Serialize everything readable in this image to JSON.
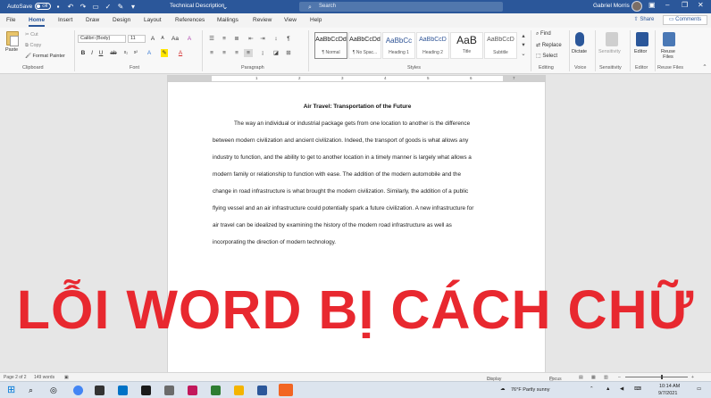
{
  "titlebar": {
    "autosave_label": "AutoSave",
    "autosave_state": "Off",
    "document_title": "Technical Description",
    "search_placeholder": "Search",
    "user_name": "Gabriel Morris"
  },
  "tabs": [
    "File",
    "Home",
    "Insert",
    "Draw",
    "Design",
    "Layout",
    "References",
    "Mailings",
    "Review",
    "View",
    "Help"
  ],
  "active_tab": "Home",
  "share_label": "Share",
  "comments_label": "Comments",
  "ribbon": {
    "clipboard": {
      "paste": "Paste",
      "cut": "Cut",
      "copy": "Copy",
      "format_painter": "Format Painter",
      "label": "Clipboard"
    },
    "font": {
      "name": "Calibri (Body)",
      "size": "11",
      "label": "Font"
    },
    "paragraph": {
      "label": "Paragraph"
    },
    "styles": {
      "items": [
        {
          "preview": "AaBbCcDd",
          "name": "¶ Normal"
        },
        {
          "preview": "AaBbCcDd",
          "name": "¶ No Spac..."
        },
        {
          "preview": "AaBbCc",
          "name": "Heading 1"
        },
        {
          "preview": "AaBbCcD",
          "name": "Heading 2"
        },
        {
          "preview": "AaB",
          "name": "Title"
        },
        {
          "preview": "AaBbCcD",
          "name": "Subtitle"
        }
      ],
      "label": "Styles"
    },
    "editing": {
      "find": "Find",
      "replace": "Replace",
      "select": "Select",
      "label": "Editing"
    },
    "voice": {
      "dictate": "Dictate",
      "label": "Voice"
    },
    "sensitivity": {
      "label": "Sensitivity",
      "btn": "Sensitivity"
    },
    "editor": {
      "btn": "Editor",
      "label": "Editor"
    },
    "reuse": {
      "btn_line1": "Reuse",
      "btn_line2": "Files",
      "label": "Reuse Files"
    }
  },
  "ruler_numbers": [
    "1",
    "2",
    "3",
    "4",
    "5",
    "6",
    "7"
  ],
  "document": {
    "heading": "Air Travel: Transportation of the Future",
    "lines": [
      "The way an individual or industrial package gets from one location to another is the difference",
      "between modern civilization and ancient civilization. Indeed, the transport of goods is what allows any",
      "industry to function, and the ability to get to another location in a timely manner is largely what allows a",
      "modern family or relationship to function with ease. The addition of the modern automobile and the",
      "change in road infrastructure is what brought the modern civilization. Similarly, the addition of a public",
      "flying vessel and an air infrastructure could potentially spark a future civilization. A new infrastructure for",
      "air travel can be idealized by examining the history of the modern road infrastructure as well as",
      "incorporating the direction of modern technology."
    ]
  },
  "overlay_text": "LỖI WORD BỊ CÁCH CHỮ",
  "statusbar": {
    "page": "Page 2 of 2",
    "words": "149 words",
    "display_settings": "Display Settings",
    "focus": "Focus"
  },
  "taskbar": {
    "weather": "76°F  Partly sunny",
    "time": "10:14 AM",
    "date": "9/7/2021"
  },
  "colors": {
    "word_blue": "#2b579a",
    "overlay_red": "#e8282f"
  }
}
